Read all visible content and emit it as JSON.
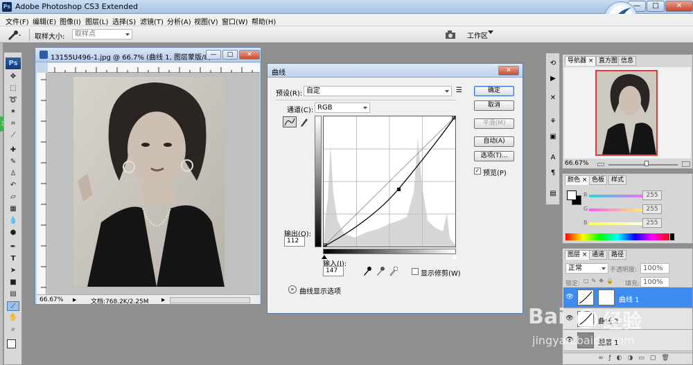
{
  "app": {
    "title": "Adobe Photoshop CS3 Extended",
    "ps_badge": "Ps"
  },
  "window_controls": {
    "minimize": "—",
    "maximize": "□",
    "close": "✕"
  },
  "menu": [
    "文件(F)",
    "编辑(E)",
    "图像(I)",
    "图层(L)",
    "选择(S)",
    "滤镜(T)",
    "分析(A)",
    "视图(V)",
    "窗口(W)",
    "帮助(H)"
  ],
  "options_bar": {
    "sample_size_label": "取样大小:",
    "sample_size_value": "取样点",
    "workspace_label": "工作区"
  },
  "toolbox": {
    "logo": "Ps",
    "tools": [
      "move-tool",
      "marquee-tool",
      "lasso-tool",
      "magic-wand-tool",
      "crop-tool",
      "slice-tool",
      "healing-brush-tool",
      "brush-tool",
      "clone-stamp-tool",
      "history-brush-tool",
      "eraser-tool",
      "gradient-tool",
      "blur-tool",
      "dodge-tool",
      "pen-tool",
      "type-tool",
      "path-selection-tool",
      "shape-tool",
      "notes-tool",
      "eyedropper-tool",
      "hand-tool",
      "zoom-tool"
    ],
    "badge": "3"
  },
  "document": {
    "title": "13155U496-1.jpg @ 66.7% (曲线 1, 图层蒙版/8)",
    "zoom": "66.67%",
    "doc_info": "文档:768.2K/2.25M"
  },
  "curves_dialog": {
    "title": "曲线",
    "preset_label": "预设(R):",
    "preset_value": "自定",
    "channel_label": "通道(C):",
    "channel_value": "RGB",
    "output_label": "输出(O):",
    "output_value": "112",
    "input_label": "输入(I):",
    "input_value": "147",
    "show_clipping_label": "显示修剪(W)",
    "curve_display_options": "曲线显示选项",
    "buttons": {
      "ok": "确定",
      "cancel": "取消",
      "smooth": "平滑(M)",
      "auto": "自动(A)",
      "options": "选项(T)..."
    },
    "preview_label": "预览(P)",
    "preview_checked": true,
    "control_point": {
      "input": 147,
      "output": 112
    }
  },
  "navigator": {
    "tabs": [
      "导航器",
      "直方图",
      "信息"
    ],
    "zoom": "66.67%"
  },
  "color_panel": {
    "tabs": [
      "颜色",
      "色板",
      "样式"
    ],
    "channels": [
      {
        "label": "R",
        "value": "255",
        "color": "#ff4040"
      },
      {
        "label": "G",
        "value": "255",
        "color": "#20c040"
      },
      {
        "label": "B",
        "value": "255",
        "color": "#4060ff"
      }
    ]
  },
  "layers_panel": {
    "tabs": [
      "图层",
      "通道",
      "路径"
    ],
    "blend_mode": "正常",
    "opacity_label": "不透明度:",
    "opacity_value": "100%",
    "lock_label": "锁定:",
    "fill_label": "填充:",
    "fill_value": "100%",
    "layers": [
      {
        "name": "曲线 1",
        "selected": true
      },
      {
        "name": "曲线 2",
        "selected": false
      },
      {
        "name": "图层 1",
        "selected": false
      }
    ]
  },
  "watermark": {
    "brand": "Bai",
    "brand_cn": "经验",
    "url": "jingyan.baidu.com"
  }
}
